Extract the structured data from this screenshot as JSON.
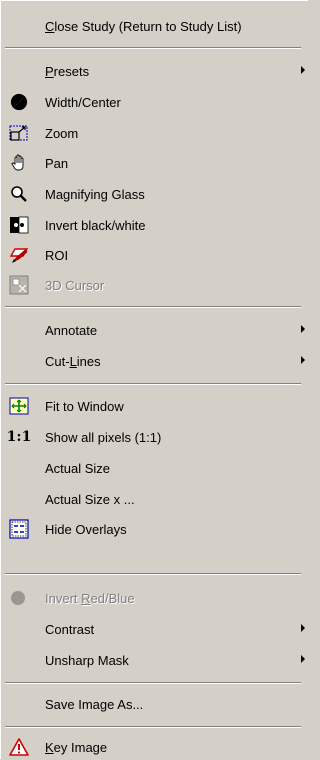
{
  "menu": {
    "close_study": {
      "pre": "",
      "key": "C",
      "post": "lose Study (Return to Study List)"
    },
    "presets": {
      "pre": "",
      "key": "P",
      "post": "resets"
    },
    "width_center": "Width/Center",
    "zoom": "Zoom",
    "pan": "Pan",
    "magnifying_glass": "Magnifying Glass",
    "invert_bw": "Invert black/white",
    "roi": "ROI",
    "cursor_3d": "3D Cursor",
    "annotate": "Annotate",
    "cut_lines": {
      "pre": "Cut-",
      "key": "L",
      "post": "ines"
    },
    "fit_to_window": "Fit to Window",
    "show_all_pixels": "Show all pixels (1:1)",
    "one_to_one_icon": "1:1",
    "actual_size": "Actual Size",
    "actual_size_x": "Actual Size x ...",
    "hide_overlays": "Hide Overlays",
    "invert_red_blue": {
      "pre": "Invert ",
      "key": "R",
      "post": "ed/Blue"
    },
    "contrast": "Contrast",
    "unsharp_mask": "Unsharp Mask",
    "save_image_as": "Save Image As...",
    "key_image": {
      "pre": "",
      "key": "K",
      "post": "ey Image"
    }
  },
  "colors": {
    "menu_bg": "#d4d0c8",
    "disabled_text": "#808080",
    "warning_red": "#cc0000"
  }
}
